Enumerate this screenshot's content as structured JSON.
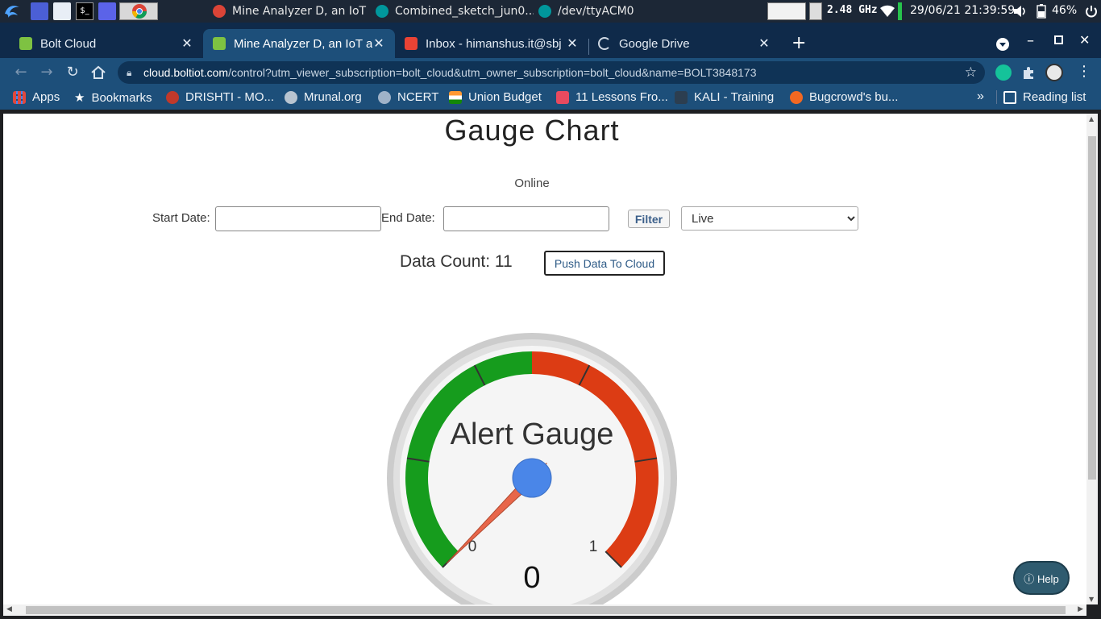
{
  "taskbar": {
    "windows": [
      {
        "label": "Mine Analyzer D, an IoT ..."
      },
      {
        "label": "Combined_sketch_jun0..."
      },
      {
        "label": "/dev/ttyACM0"
      }
    ],
    "cpu_freq": "2.48 GHz",
    "clock": "29/06/21 21:39:59",
    "battery": "46%"
  },
  "tabs": [
    {
      "label": "Bolt Cloud"
    },
    {
      "label": "Mine Analyzer D, an IoT an"
    },
    {
      "label": "Inbox - himanshus.it@sbj"
    },
    {
      "label": "Google Drive"
    }
  ],
  "omnibox": {
    "host": "cloud.boltiot.com",
    "path": "/control?utm_viewer_subscription=bolt_cloud&utm_owner_subscription=bolt_cloud&name=BOLT3848173"
  },
  "bookmarks": [
    {
      "label": "Apps",
      "color": "#e0483e"
    },
    {
      "label": "Bookmarks",
      "color": "#dfe6ee"
    },
    {
      "label": "DRISHTI - MO...",
      "color": "#c0392b"
    },
    {
      "label": "Mrunal.org",
      "color": "#b8c4d0"
    },
    {
      "label": "NCERT",
      "color": "#9fb2c8"
    },
    {
      "label": "Union Budget",
      "color": "#f39c12"
    },
    {
      "label": "11 Lessons Fro...",
      "color": "#e84a5f"
    },
    {
      "label": "KALI - Training",
      "color": "#2c3e50"
    },
    {
      "label": "Bugcrowd's bu...",
      "color": "#f26822"
    }
  ],
  "bookmarks_overflow": "»",
  "reading_list": "Reading list",
  "page": {
    "title": "Gauge Chart",
    "status": "Online",
    "start_label": "Start Date:",
    "end_label": "End Date:",
    "filter_label": "Filter",
    "mode_selected": "Live",
    "data_count": "Data Count: 11",
    "push_label": "Push Data To Cloud",
    "help_label": "Help"
  },
  "chart_data": {
    "type": "gauge",
    "title": "Alert Gauge",
    "min": 0,
    "max": 1,
    "value": 0,
    "min_label": "0",
    "max_label": "1",
    "value_label": "0",
    "bands": [
      {
        "from": 0,
        "to": 0.5,
        "color": "#169c1d"
      },
      {
        "from": 0.5,
        "to": 1,
        "color": "#dc3c14"
      }
    ],
    "needle_color": "#e8664a",
    "hub_color": "#4a86e8"
  }
}
